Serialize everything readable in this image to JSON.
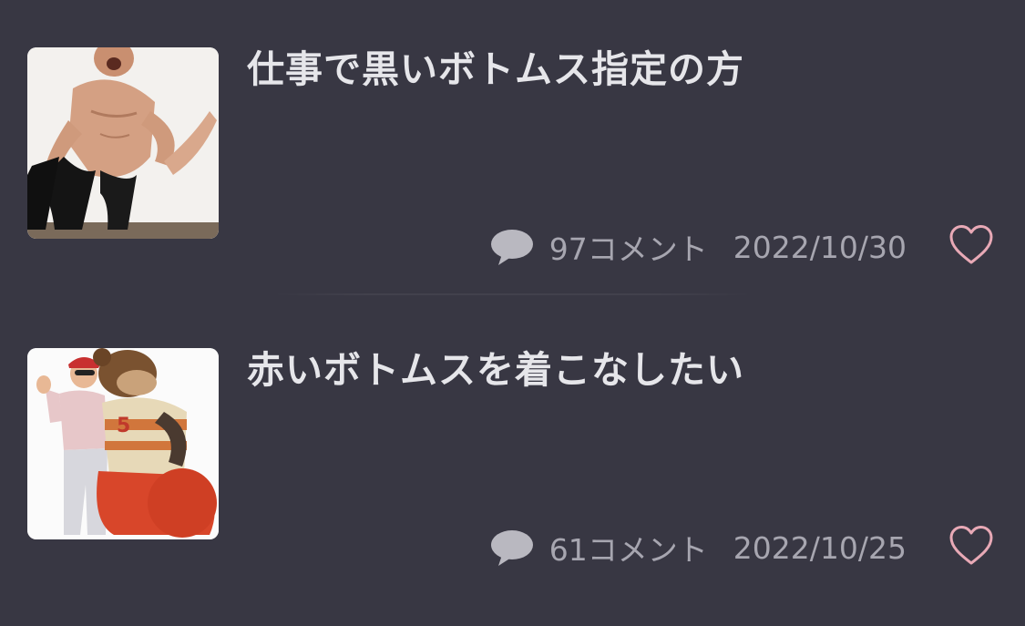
{
  "posts": [
    {
      "thumbnail": "muscular-man-black-tights-photo",
      "title": "仕事で黒いボトムス指定の方",
      "comments": "97コメント",
      "date": "2022/10/30",
      "comment_icon": "speech-bubble-icon",
      "like_icon": "heart-outline-icon",
      "like_color": "#e8a9b6"
    },
    {
      "thumbnail": "man-with-bear-mascot-photo",
      "title": "赤いボトムスを着こなしたい",
      "comments": "61コメント",
      "date": "2022/10/25",
      "comment_icon": "speech-bubble-icon",
      "like_icon": "heart-outline-icon",
      "like_color": "#e8a9b6"
    }
  ],
  "colors": {
    "background": "#383743",
    "title": "#e6e6ea",
    "meta": "#a7a6b0",
    "heart": "#e8a9b6"
  }
}
